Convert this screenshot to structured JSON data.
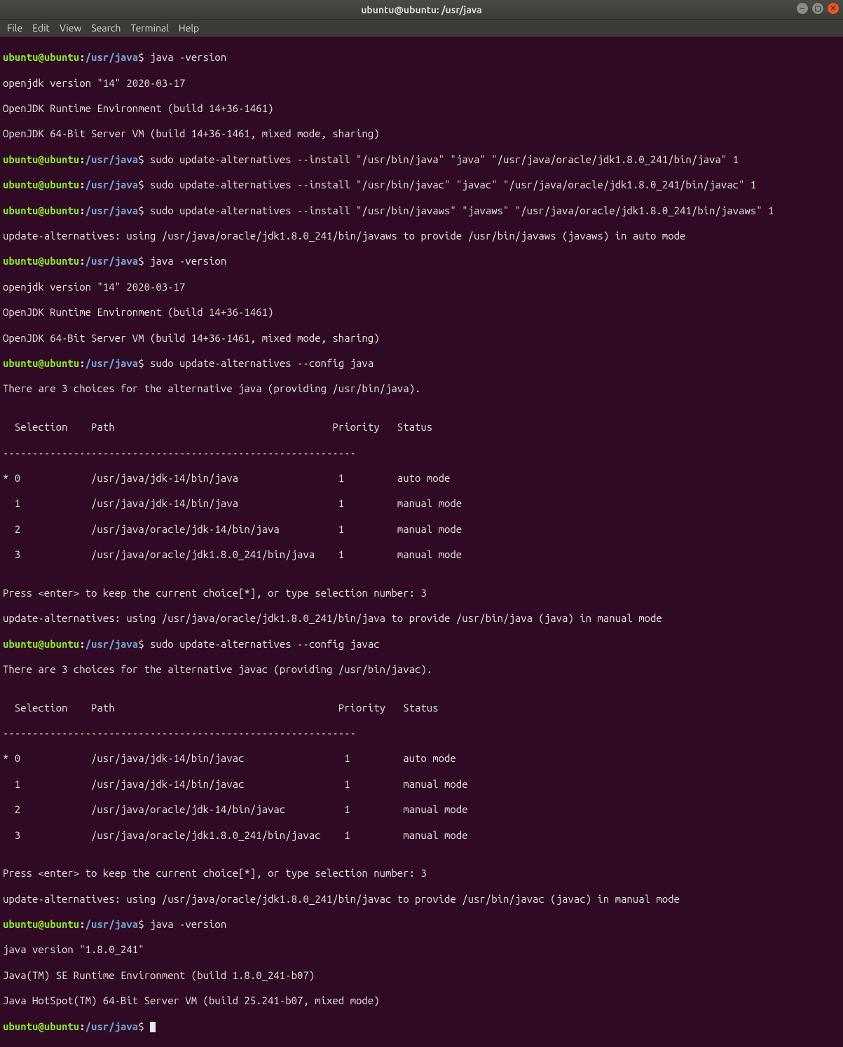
{
  "window": {
    "title": "ubuntu@ubuntu: /usr/java"
  },
  "menu": {
    "file": "File",
    "edit": "Edit",
    "view": "View",
    "search": "Search",
    "terminal": "Terminal",
    "help": "Help"
  },
  "prompt": {
    "user": "ubuntu@ubuntu",
    "colon": ":",
    "path": "/usr/java",
    "dollar": "$"
  },
  "lines": {
    "l1_cmd": " java -version",
    "l2": "openjdk version \"14\" 2020-03-17",
    "l3": "OpenJDK Runtime Environment (build 14+36-1461)",
    "l4": "OpenJDK 64-Bit Server VM (build 14+36-1461, mixed mode, sharing)",
    "l5_cmd": " sudo update-alternatives --install \"/usr/bin/java\" \"java\" \"/usr/java/oracle/jdk1.8.0_241/bin/java\" 1",
    "l6_cmd": " sudo update-alternatives --install \"/usr/bin/javac\" \"javac\" \"/usr/java/oracle/jdk1.8.0_241/bin/javac\" 1",
    "l7_cmd": " sudo update-alternatives --install \"/usr/bin/javaws\" \"javaws\" \"/usr/java/oracle/jdk1.8.0_241/bin/javaws\" 1",
    "l8": "update-alternatives: using /usr/java/oracle/jdk1.8.0_241/bin/javaws to provide /usr/bin/javaws (javaws) in auto mode",
    "l9_cmd": " java -version",
    "l10": "openjdk version \"14\" 2020-03-17",
    "l11": "OpenJDK Runtime Environment (build 14+36-1461)",
    "l12": "OpenJDK 64-Bit Server VM (build 14+36-1461, mixed mode, sharing)",
    "l13_cmd": " sudo update-alternatives --config java",
    "l14": "There are 3 choices for the alternative java (providing /usr/bin/java).",
    "l15": "",
    "l16": "  Selection    Path                                     Priority   Status",
    "l17": "------------------------------------------------------------",
    "l18": "* 0            /usr/java/jdk-14/bin/java                 1         auto mode",
    "l19": "  1            /usr/java/jdk-14/bin/java                 1         manual mode",
    "l20": "  2            /usr/java/oracle/jdk-14/bin/java          1         manual mode",
    "l21": "  3            /usr/java/oracle/jdk1.8.0_241/bin/java    1         manual mode",
    "l22": "",
    "l23": "Press <enter> to keep the current choice[*], or type selection number: 3",
    "l24": "update-alternatives: using /usr/java/oracle/jdk1.8.0_241/bin/java to provide /usr/bin/java (java) in manual mode",
    "l25_cmd": " sudo update-alternatives --config javac",
    "l26": "There are 3 choices for the alternative javac (providing /usr/bin/javac).",
    "l27": "",
    "l28": "  Selection    Path                                      Priority   Status",
    "l29": "------------------------------------------------------------",
    "l30": "* 0            /usr/java/jdk-14/bin/javac                 1         auto mode",
    "l31": "  1            /usr/java/jdk-14/bin/javac                 1         manual mode",
    "l32": "  2            /usr/java/oracle/jdk-14/bin/javac          1         manual mode",
    "l33": "  3            /usr/java/oracle/jdk1.8.0_241/bin/javac    1         manual mode",
    "l34": "",
    "l35": "Press <enter> to keep the current choice[*], or type selection number: 3",
    "l36": "update-alternatives: using /usr/java/oracle/jdk1.8.0_241/bin/javac to provide /usr/bin/javac (javac) in manual mode",
    "l37_cmd": " java -version",
    "l38": "java version \"1.8.0_241\"",
    "l39": "Java(TM) SE Runtime Environment (build 1.8.0_241-b07)",
    "l40": "Java HotSpot(TM) 64-Bit Server VM (build 25.241-b07, mixed mode)",
    "l41_cmd": " "
  }
}
